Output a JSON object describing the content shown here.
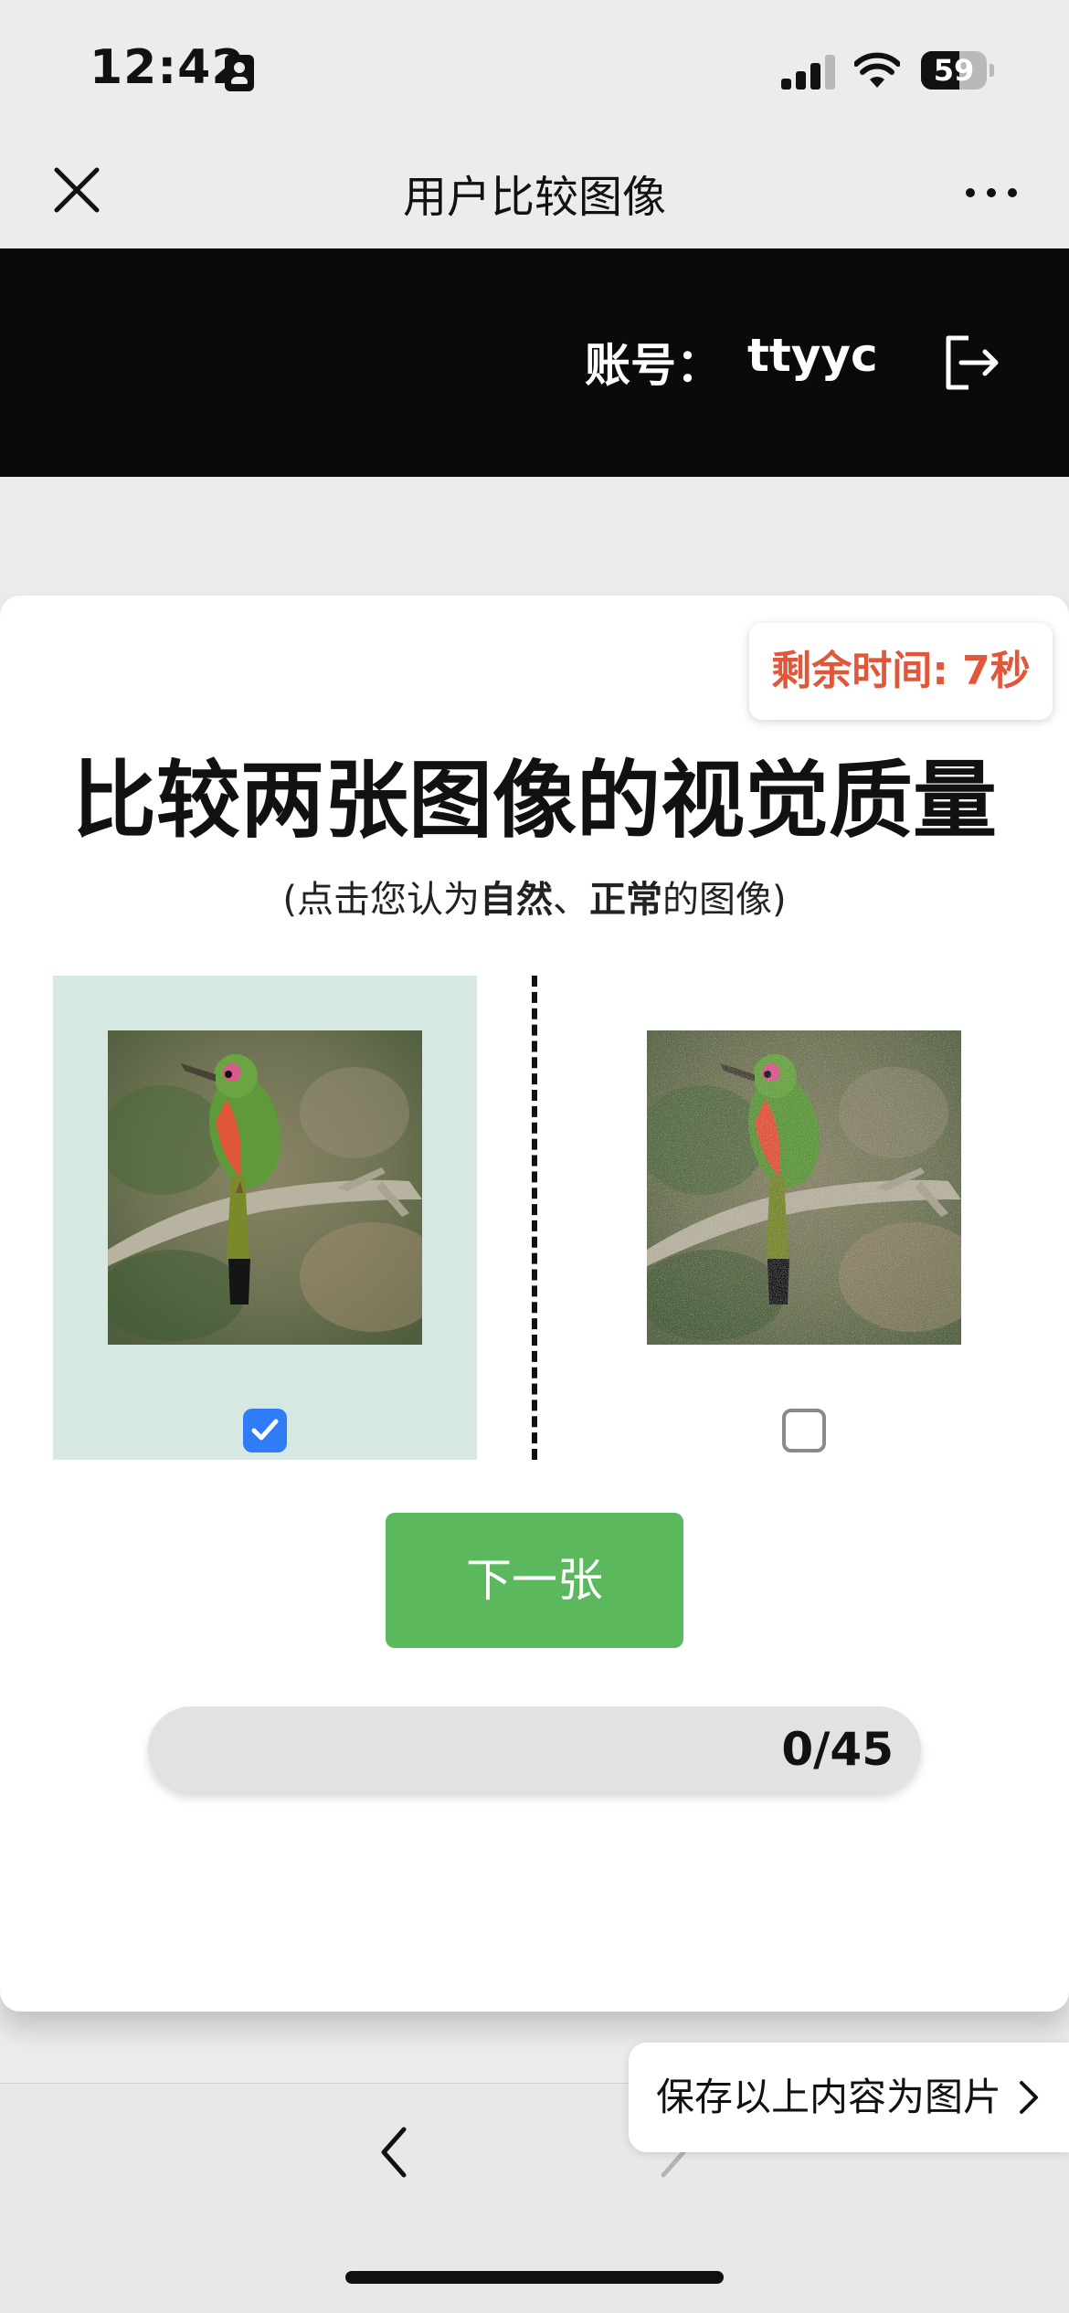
{
  "status_bar": {
    "time": "12:42",
    "battery_level": "59",
    "battery_fraction": 0.59
  },
  "nav": {
    "title": "用户比较图像",
    "close_icon": "close-icon",
    "more_icon": "more-icon"
  },
  "header": {
    "account_label": "账号：",
    "account_value": "ttyyc",
    "logout_icon": "logout-icon"
  },
  "card": {
    "timer": "剩余时间: 7秒",
    "title": "比较两张图像的视觉质量",
    "subtitle_prefix": "(点击您认为",
    "subtitle_bold1": "自然",
    "subtitle_sep": "、",
    "subtitle_bold2": "正常",
    "subtitle_suffix": "的图像)",
    "left_option": {
      "selected": true
    },
    "right_option": {
      "selected": false
    },
    "next_button": "下一张",
    "progress_text": "0/45",
    "progress_value": 0,
    "progress_total": 45
  },
  "bottom": {
    "save_label": "保存以上内容为图片",
    "back_icon": "chevron-left-icon",
    "forward_icon": "chevron-right-icon"
  },
  "colors": {
    "selected_bg": "#d5e9e2",
    "next_button": "#5cb85c",
    "timer_text": "#e0573a",
    "checkbox_checked": "#2f7cf6"
  }
}
